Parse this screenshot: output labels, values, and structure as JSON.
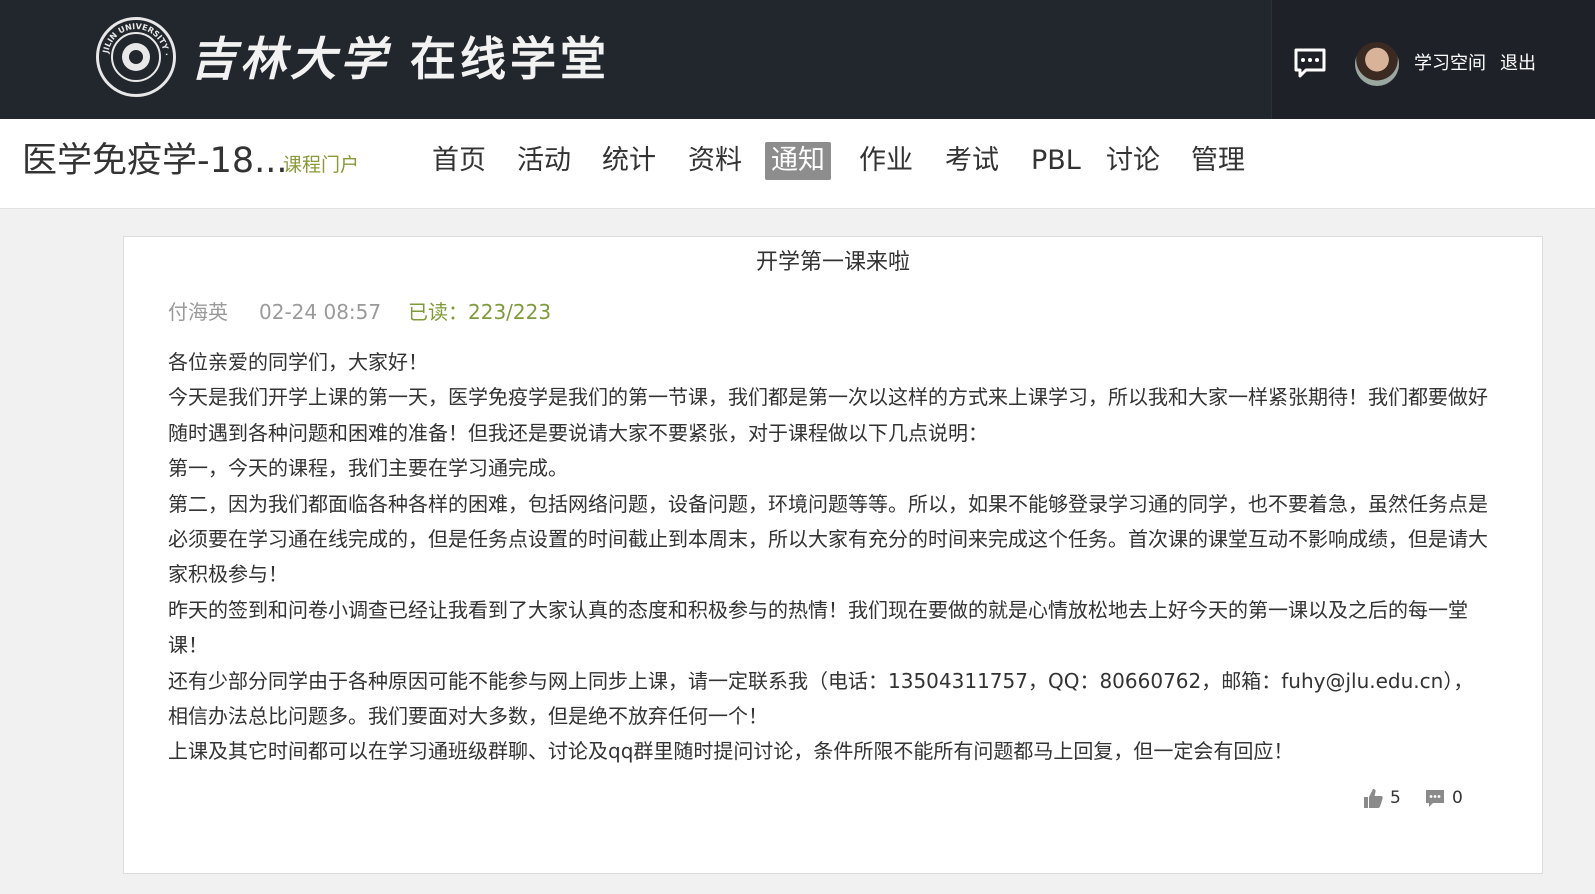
{
  "header": {
    "logo_text": "吉林大学 在线学堂",
    "logo_script_part": "吉林大学",
    "logo_bold_part": "在线学堂",
    "seal_text": "JILIN UNIVERSITY · CHINA",
    "links": {
      "study_space": "学习空间",
      "logout": "退出"
    },
    "icons": {
      "messages": "chat-bubble-icon",
      "avatar": "user-avatar"
    }
  },
  "course": {
    "title": "医学免疫学-18...",
    "portal_link": "课程门户"
  },
  "nav": {
    "tabs": [
      {
        "label": "首页"
      },
      {
        "label": "活动"
      },
      {
        "label": "统计"
      },
      {
        "label": "资料"
      },
      {
        "label": "通知"
      },
      {
        "label": "作业"
      },
      {
        "label": "考试"
      },
      {
        "label": "PBL"
      },
      {
        "label": "讨论"
      },
      {
        "label": "管理"
      }
    ],
    "active_tab": "通知"
  },
  "notice": {
    "title": "开学第一课来啦",
    "author": "付海英",
    "time": "02-24 08:57",
    "read_status": "已读：223/223",
    "paragraphs": [
      "各位亲爱的同学们，大家好！",
      "今天是我们开学上课的第一天，医学免疫学是我们的第一节课，我们都是第一次以这样的方式来上课学习，所以我和大家一样紧张期待！我们都要做好随时遇到各种问题和困难的准备！但我还是要说请大家不要紧张，对于课程做以下几点说明：",
      "第一，今天的课程，我们主要在学习通完成。",
      "第二，因为我们都面临各种各样的困难，包括网络问题，设备问题，环境问题等等。所以，如果不能够登录学习通的同学，也不要着急，虽然任务点是必须要在学习通在线完成的，但是任务点设置的时间截止到本周末，所以大家有充分的时间来完成这个任务。首次课的课堂互动不影响成绩，但是请大家积极参与！",
      "昨天的签到和问卷小调查已经让我看到了大家认真的态度和积极参与的热情！我们现在要做的就是心情放松地去上好今天的第一课以及之后的每一堂课！",
      "还有少部分同学由于各种原因可能不能参与网上同步上课，请一定联系我（电话：13504311757，QQ：80660762，邮箱：fuhy@jlu.edu.cn），相信办法总比问题多。我们要面对大多数，但是绝不放弃任何一个！",
      "上课及其它时间都可以在学习通班级群聊、讨论及qq群里随时提问讨论，条件所限不能所有问题都马上回复，但一定会有回应！"
    ],
    "likes": "5",
    "comments": "0"
  },
  "colors": {
    "header_bg": "#22262d",
    "active_tab_bg": "#8d8d8d",
    "green_accent": "#7f9a3a",
    "page_bg": "#f1f1f1"
  }
}
